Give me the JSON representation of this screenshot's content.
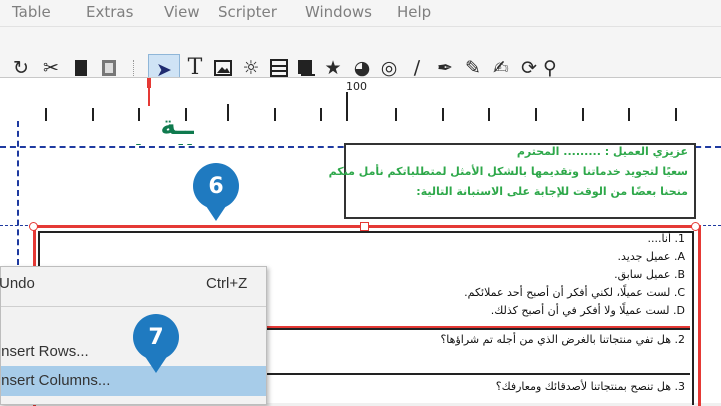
{
  "menubar": {
    "items": [
      "Table",
      "Extras",
      "View",
      "Scripter",
      "Windows",
      "Help"
    ]
  },
  "toolbar": {
    "icons": [
      "undo-icon",
      "cut-icon",
      "copy-icon",
      "paste-icon",
      "select-icon",
      "text-frame-icon",
      "image-frame-icon",
      "render-frame-icon",
      "table-icon",
      "shape-icon",
      "polygon-icon",
      "arc-icon",
      "spiral-icon",
      "line-icon",
      "bezier-icon",
      "freehand-icon",
      "calligraphy-icon",
      "rotate-icon",
      "zoom-icon"
    ]
  },
  "ruler": {
    "label_100": "100"
  },
  "document": {
    "greeting_heading": "عزيزي العميل : ......... المحترم",
    "greeting_line1": "سعيًا لتجويد خدماتنا وتقديمها بالشكل الأمثل لمتطلباتكم نأمل منكم",
    "greeting_line2": "منحنا بعضًا من الوقت للإجابة على الاستبانة التالية:",
    "q1": "1. أنا....",
    "q1_a": "A. عميل جديد.",
    "q1_b": "B. عميل سابق.",
    "q1_c": "C. لست عميلًا، لكني أفكر أن أصبح أحد عملائكم.",
    "q1_d": "D. لست عميلًا ولا أفكر في أن أصبح كذلك.",
    "q2": "2. هل تفي منتجاتنا بالغرض الذي من أجله تم شراؤها؟",
    "q3": "3. هل تنصح بمنتجاتنا لأصدقائك ومعارفك؟",
    "logo_text": "ــة المدائن"
  },
  "context_menu": {
    "undo_label": "Undo",
    "undo_shortcut": "Ctrl+Z",
    "insert_rows_label": "Insert Rows...",
    "insert_columns_label": "Insert Columns..."
  },
  "callouts": {
    "step6": "6",
    "step7": "7"
  },
  "colors": {
    "accent_blue": "#1f7ac0",
    "selection_red": "#e53935",
    "highlight_blue": "#a7cce9"
  }
}
